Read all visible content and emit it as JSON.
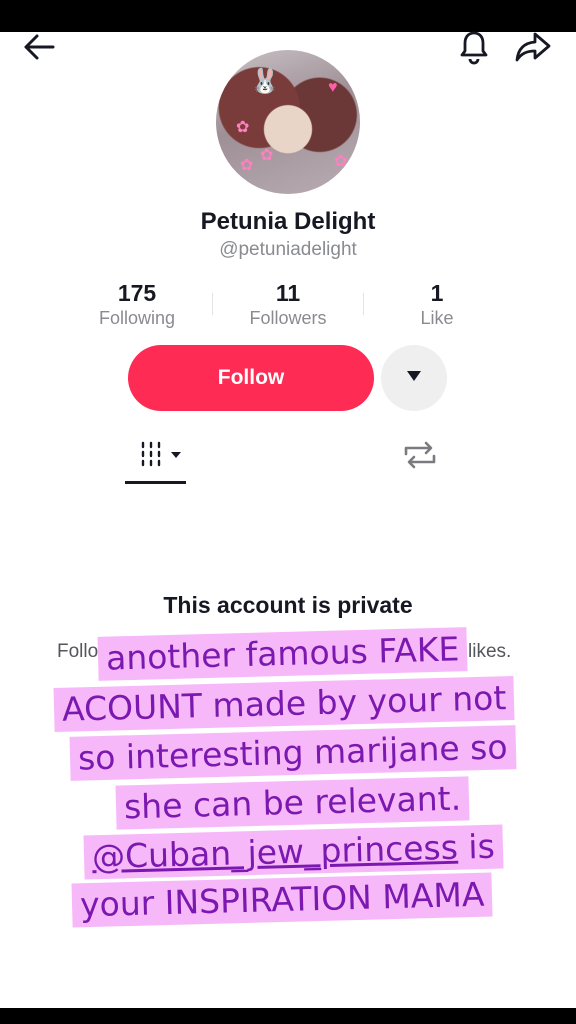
{
  "header": {
    "back_icon": "arrow-left-icon",
    "bell_icon": "bell-icon",
    "share_icon": "share-arrow-icon"
  },
  "profile": {
    "display_name": "Petunia Delight",
    "username": "@petuniadelight"
  },
  "stats": [
    {
      "value": "175",
      "label": "Following"
    },
    {
      "value": "11",
      "label": "Followers"
    },
    {
      "value": "1",
      "label": "Like"
    }
  ],
  "actions": {
    "follow_label": "Follow",
    "more_icon": "triangle-down-icon"
  },
  "tabs": [
    {
      "icon": "grid-icon",
      "selected": true
    },
    {
      "icon": "repost-icon",
      "selected": false
    }
  ],
  "private_notice": {
    "title": "This account is private",
    "desc_left": "Follo",
    "desc_right": "likes."
  },
  "overlay_text": {
    "line1": "another famous FAKE",
    "line2": "ACOUNT made by your not",
    "line3": "so interesting marijane so",
    "line4": "she can be relevant.",
    "line5_mention": "@Cuban_jew_princess",
    "line5_rest": " is",
    "line6": "your INSPIRATION MAMA"
  },
  "colors": {
    "accent": "#fe2c55",
    "overlay_bg": "#f6b8f8",
    "overlay_text": "#7a18b0"
  }
}
